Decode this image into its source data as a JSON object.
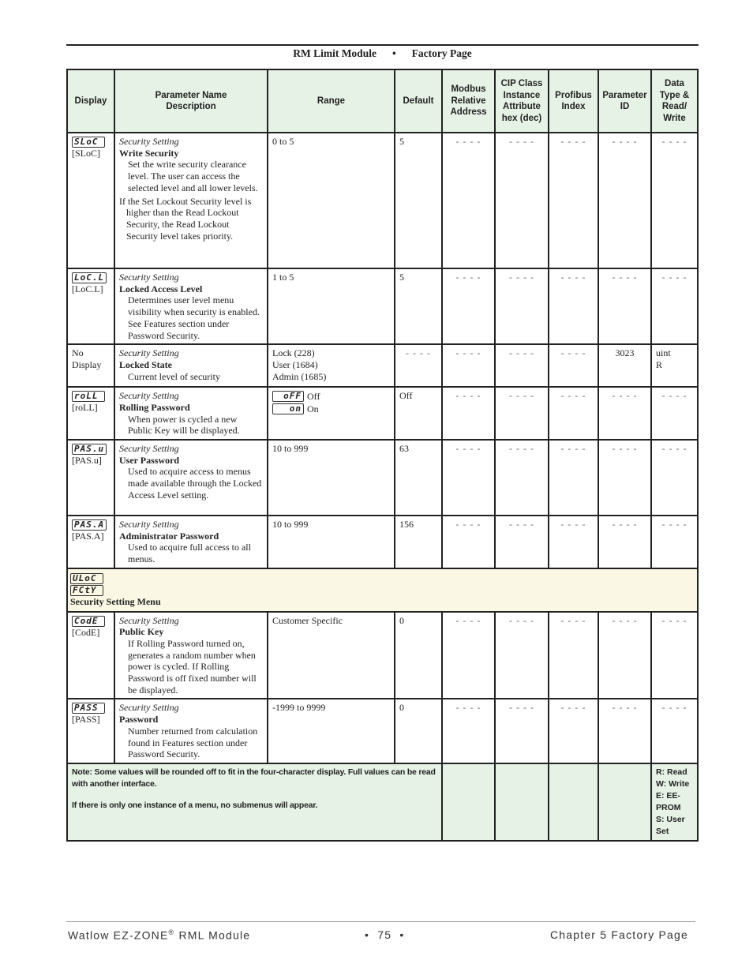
{
  "header": {
    "module": "RM Limit Module",
    "separator": "•",
    "page": "Factory Page"
  },
  "table": {
    "columns": [
      "Display",
      "Parameter Name Description",
      "Range",
      "Default",
      "Modbus Relative Address",
      "CIP Class Instance Attribute hex (dec)",
      "Profibus Index",
      "Parameter ID",
      "Data Type & Read/ Write"
    ],
    "rows": [
      {
        "lcd": "SLoC",
        "code": "[SLoC]",
        "category": "Security Setting",
        "name": "Write Security",
        "desc": "Set the write security clearance level. The user can access the selected level and all lower levels.",
        "desc2": "If the Set Lockout Security level is higher than the Read Lockout Security, the Read Lockout Security level takes priority.",
        "range": [
          "0 to 5"
        ],
        "default": "5",
        "modbus": "- - - -",
        "cip": "- - - -",
        "profibus": "- - - -",
        "param_id": "- - - -",
        "data_type": "- - - -"
      },
      {
        "lcd": "LoC.L",
        "code": "[LoC.L]",
        "category": "Security Setting",
        "name": "Locked Access Level",
        "desc": "Determines user level menu visibility when security is enabled. See Features section under Password Security.",
        "range": [
          "1 to 5"
        ],
        "default": "5",
        "modbus": "- - - -",
        "cip": "- - - -",
        "profibus": "- - - -",
        "param_id": "- - - -",
        "data_type": "- - - -"
      },
      {
        "display_text": "No Display",
        "category": "Security Setting",
        "name": "Locked State",
        "desc": "Current level of security",
        "range": [
          "Lock (228)",
          "User (1684)",
          "Admin (1685)"
        ],
        "default": "- - - -",
        "modbus": "- - - -",
        "cip": "- - - -",
        "profibus": "- - - -",
        "param_id": "3023",
        "data_type": "uint R"
      },
      {
        "lcd": "roLL",
        "code": "[roLL]",
        "category": "Security Setting",
        "name": "Rolling Password",
        "desc": "When power is cycled a new Public Key will be displayed.",
        "range_options": [
          {
            "lcd": "oFF",
            "label": "Off"
          },
          {
            "lcd": "on",
            "label": "On"
          }
        ],
        "default": "Off",
        "modbus": "- - - -",
        "cip": "- - - -",
        "profibus": "- - - -",
        "param_id": "- - - -",
        "data_type": "- - - -"
      },
      {
        "lcd": "PAS.u",
        "code": "[PAS.u]",
        "category": "Security Setting",
        "name": "User Password",
        "desc": "Used to acquire access to menus made available through the Locked Access Level setting.",
        "range": [
          "10 to 999"
        ],
        "default": "63",
        "modbus": "- - - -",
        "cip": "- - - -",
        "profibus": "- - - -",
        "param_id": "- - - -",
        "data_type": "- - - -"
      },
      {
        "lcd": "PAS.A",
        "code": "[PAS.A]",
        "category": "Security Setting",
        "name": "Administrator Password",
        "desc": "Used to acquire full access to all menus.",
        "range": [
          "10 to 999"
        ],
        "default": "156",
        "modbus": "- - - -",
        "cip": "- - - -",
        "profibus": "- - - -",
        "param_id": "- - - -",
        "data_type": "- - - -"
      }
    ],
    "menu": {
      "lcd1": "ULoC",
      "lcd2": "FCtY",
      "title": "Security Setting Menu"
    },
    "rows2": [
      {
        "lcd": "CodE",
        "code": "[CodE]",
        "category": "Security Setting",
        "name": "Public Key",
        "desc": "If Rolling Password turned on, generates a random number when power is cycled. If Rolling Password is off fixed number will be displayed.",
        "range": [
          "Customer Specific"
        ],
        "default": "0",
        "modbus": "- - - -",
        "cip": "- - - -",
        "profibus": "- - - -",
        "param_id": "- - - -",
        "data_type": "- - - -"
      },
      {
        "lcd": "PASS",
        "code": "[PASS]",
        "category": "Security Setting",
        "name": "Password",
        "desc": "Number returned from calculation found in Features section under Password Security.",
        "range": [
          "-1999 to 9999"
        ],
        "default": "0",
        "modbus": "- - - -",
        "cip": "- - - -",
        "profibus": "- - - -",
        "param_id": "- - - -",
        "data_type": "- - - -"
      }
    ],
    "note": {
      "line1": "Note: Some values will be rounded off to fit in the four-character display. Full values can be read with another interface.",
      "line2": "If there is only one instance of a menu, no submenus will appear.",
      "legend": [
        "R: Read",
        "W: Write",
        "E: EE-PROM",
        "S: User Set"
      ]
    }
  },
  "footer": {
    "product": "Watlow EZ-ZONE",
    "reg": "®",
    "product_suffix": " RML Module",
    "page_number": "•  75  •",
    "chapter": "Chapter 5 Factory Page"
  },
  "colors": {
    "header_bg": "#e6f2e6",
    "menu_bg": "#faf8e4",
    "border": "#222222"
  }
}
